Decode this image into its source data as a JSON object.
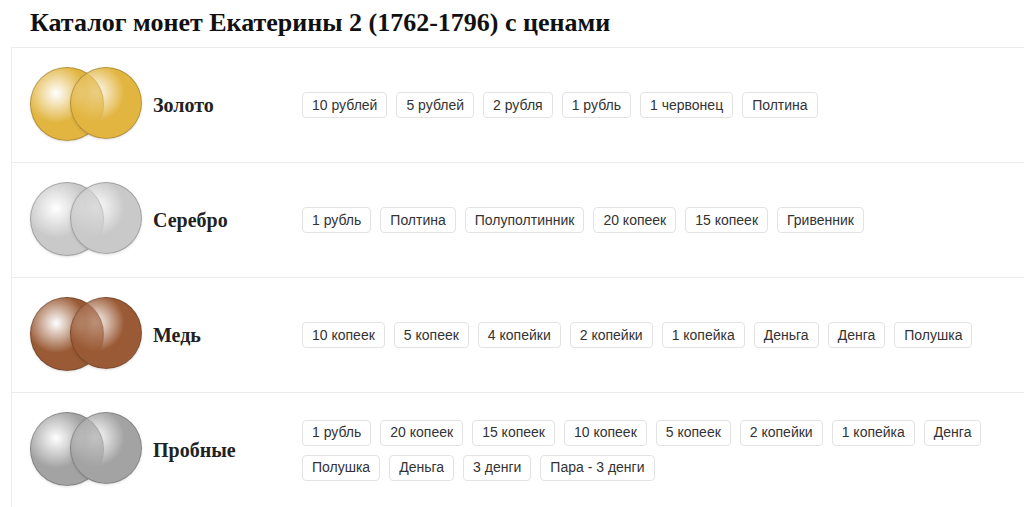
{
  "title": "Каталог монет Екатерины 2 (1762-1796) с ценами",
  "categories": [
    {
      "label": "Золото",
      "color": "#e2b541",
      "denominations": [
        "10 рублей",
        "5 рублей",
        "2 рубля",
        "1 рубль",
        "1 червонец",
        "Полтина"
      ]
    },
    {
      "label": "Серебро",
      "color": "#c9c9c9",
      "denominations": [
        "1 рубль",
        "Полтина",
        "Полуполтинник",
        "20 копеек",
        "15 копеек",
        "Гривенник"
      ]
    },
    {
      "label": "Медь",
      "color": "#9a5a35",
      "denominations": [
        "10 копеек",
        "5 копеек",
        "4 копейки",
        "2 копейки",
        "1 копейка",
        "Деньга",
        "Денга",
        "Полушка"
      ]
    },
    {
      "label": "Пробные",
      "color": "#a3a3a3",
      "denominations": [
        "1 рубль",
        "20 копеек",
        "15 копеек",
        "10 копеек",
        "5 копеек",
        "2 копейки",
        "1 копейка",
        "Денга",
        "Полушка",
        "Деньга",
        "3 денги",
        "Пара - 3 денги"
      ]
    }
  ]
}
